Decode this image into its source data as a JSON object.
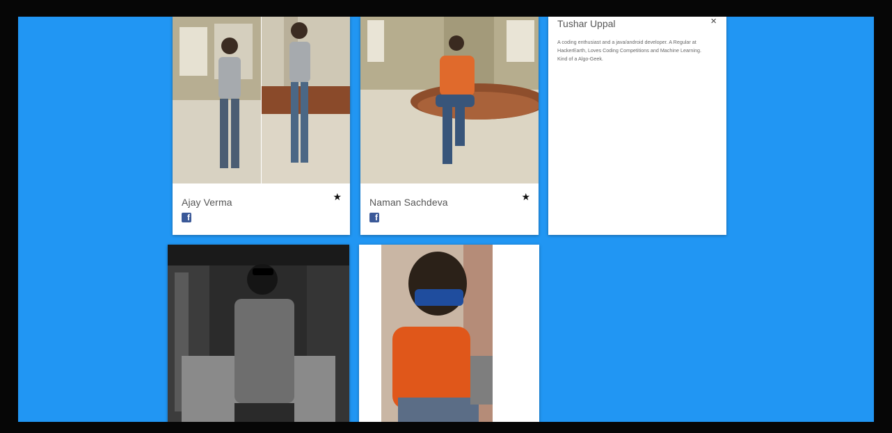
{
  "cards": [
    {
      "name": "Ajay Verma",
      "star_icon": "★",
      "social_icon": "f"
    },
    {
      "name": "Naman Sachdeva",
      "star_icon": "★",
      "social_icon": "f"
    }
  ],
  "reveal": {
    "name": "Tushar Uppal",
    "close_icon": "×",
    "bio": "A coding enthusiast and a java/android developer. A Regular at HackerEarth, Loves Coding Competitions and Machine Learning. Kind of a Algo-Geek."
  },
  "colors": {
    "background": "#2196f3",
    "frame": "#060606",
    "card": "#ffffff",
    "facebook": "#3b5998"
  },
  "icons": [
    "star-icon",
    "facebook-icon",
    "close-icon"
  ]
}
